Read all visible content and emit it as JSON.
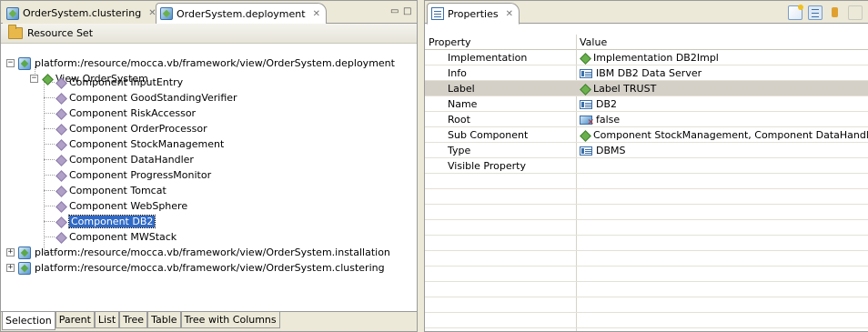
{
  "left_pane": {
    "tabs": [
      {
        "label": "OrderSystem.clustering",
        "active": false
      },
      {
        "label": "OrderSystem.deployment",
        "active": true
      }
    ],
    "window_controls": [
      "minimize",
      "maximize"
    ],
    "resource_set_label": "Resource Set",
    "tree": {
      "root": "platform:/resource/mocca.vb/framework/view/OrderSystem.deployment",
      "view": "View OrderSystem",
      "components": [
        "Component InputEntry",
        "Component GoodStandingVerifier",
        "Component RiskAccessor",
        "Component OrderProcessor",
        "Component StockManagement",
        "Component DataHandler",
        "Component ProgressMonitor",
        "Component Tomcat",
        "Component WebSphere",
        "Component DB2",
        "Component MWStack"
      ],
      "selected": "Component DB2",
      "other_roots": [
        "platform:/resource/mocca.vb/framework/view/OrderSystem.installation",
        "platform:/resource/mocca.vb/framework/view/OrderSystem.clustering"
      ]
    },
    "bottom_tabs": [
      "Selection",
      "Parent",
      "List",
      "Tree",
      "Table",
      "Tree with Columns"
    ],
    "bottom_tab_active": "Selection"
  },
  "right_pane": {
    "tab_label": "Properties",
    "toolbar_icons": [
      "new-icon",
      "show-categories-icon",
      "show-advanced-icon",
      "restore-default-icon"
    ],
    "columns": {
      "property": "Property",
      "value": "Value"
    },
    "rows": [
      {
        "property": "Implementation",
        "value": "Implementation DB2Impl",
        "icon": "component-icon"
      },
      {
        "property": "Info",
        "value": "IBM DB2 Data Server",
        "icon": "list-icon"
      },
      {
        "property": "Label",
        "value": "Label TRUST",
        "icon": "component-icon",
        "selected": true
      },
      {
        "property": "Name",
        "value": "DB2",
        "icon": "list-icon"
      },
      {
        "property": "Root",
        "value": "false",
        "icon": "boolean-icon"
      },
      {
        "property": "Sub Component",
        "value": "Component StockManagement, Component DataHandler",
        "icon": "component-icon"
      },
      {
        "property": "Type",
        "value": "DBMS",
        "icon": "list-icon"
      },
      {
        "property": "Visible Property",
        "value": "",
        "icon": ""
      }
    ]
  },
  "colors": {
    "selection": "#316ac5",
    "row_highlight": "#d4d0c8",
    "chrome": "#ece9d8"
  }
}
